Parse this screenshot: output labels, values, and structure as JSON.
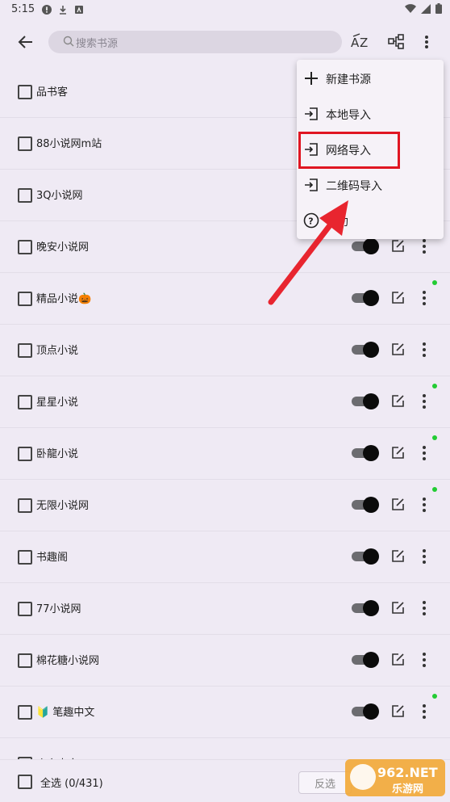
{
  "status_bar": {
    "time": "5:15"
  },
  "toolbar": {
    "search_placeholder": "搜索书源",
    "sort_label": "AZ"
  },
  "sources": [
    {
      "name": "品书客",
      "enabled": false,
      "update_dot": false,
      "show_controls": false
    },
    {
      "name": "88小说网m站",
      "enabled": false,
      "update_dot": false,
      "show_controls": false
    },
    {
      "name": "3Q小说网",
      "enabled": false,
      "update_dot": false,
      "show_controls": false
    },
    {
      "name": "晚安小说网",
      "enabled": true,
      "update_dot": false,
      "show_controls": true
    },
    {
      "name": "精品小说🎃",
      "enabled": true,
      "update_dot": true,
      "show_controls": true
    },
    {
      "name": "顶点小说",
      "enabled": true,
      "update_dot": false,
      "show_controls": true
    },
    {
      "name": "星星小说",
      "enabled": true,
      "update_dot": true,
      "show_controls": true
    },
    {
      "name": "卧龍小说",
      "enabled": true,
      "update_dot": true,
      "show_controls": true
    },
    {
      "name": "无限小说网",
      "enabled": true,
      "update_dot": true,
      "show_controls": true
    },
    {
      "name": "书趣阁",
      "enabled": true,
      "update_dot": false,
      "show_controls": true
    },
    {
      "name": "77小说网",
      "enabled": true,
      "update_dot": false,
      "show_controls": true
    },
    {
      "name": "棉花糖小说网",
      "enabled": true,
      "update_dot": false,
      "show_controls": true
    },
    {
      "name": "🔰 笔趣中文",
      "enabled": true,
      "update_dot": true,
      "show_controls": true
    },
    {
      "name": "广安中文",
      "enabled": true,
      "update_dot": false,
      "show_controls": false
    }
  ],
  "bottom_bar": {
    "select_all_label": "全选 (0/431)",
    "invert_label": "反选"
  },
  "menu": {
    "items": [
      {
        "label": "新建书源",
        "icon": "plus-icon"
      },
      {
        "label": "本地导入",
        "icon": "import-icon"
      },
      {
        "label": "网络导入",
        "icon": "import-icon"
      },
      {
        "label": "二维码导入",
        "icon": "import-icon"
      },
      {
        "label": "帮助",
        "icon": "help-icon"
      }
    ]
  },
  "watermark": {
    "text_top": "962.NET",
    "text_bottom": "乐游网"
  },
  "colors": {
    "background": "#efeaf4",
    "highlight": "#e01622",
    "arrow": "#e8252f",
    "update_dot": "#22cc33"
  }
}
